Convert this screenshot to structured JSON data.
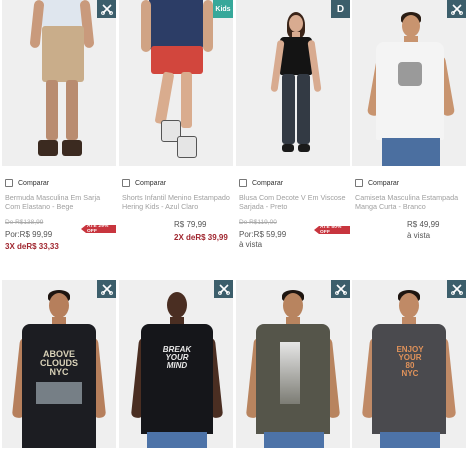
{
  "colors": {
    "badge": "#3c5e6b",
    "badge_kids": "#36a89a",
    "sale": "#a0262f",
    "promo": "#c8353e"
  },
  "compare_label": "Comparar",
  "products_top": [
    {
      "badge": "scissors-icon",
      "name": "Bermuda Masculina Em Sarja Com Elastano - Bege",
      "old_price": "De R$138,99",
      "price": "Por:R$ 99,99",
      "installment": "3X deR$ 33,33",
      "promo": "ATÉ 29% OFF"
    },
    {
      "badge_text": "Kids",
      "name": "Shorts Infantil Menino Estampado Hering Kids - Azul Claro",
      "price": "R$ 79,99",
      "installment": "2X deR$ 39,99"
    },
    {
      "badge_text": "D",
      "name": "Blusa Com Decote V Em Viscose Sarjada - Preto",
      "old_price": "De R$119,00",
      "price": "Por:R$ 59,99",
      "vista": "à vista",
      "promo": "ATÉ 50% OFF"
    },
    {
      "badge": "scissors-icon",
      "name": "Camiseta Masculina Estampada Manga Curta - Branco",
      "price": "R$ 49,99",
      "vista": "à vista"
    }
  ],
  "products_bottom": [
    {
      "badge": "scissors-icon",
      "print": "ABOVE\nCLOUDS\nNYC"
    },
    {
      "badge": "scissors-icon",
      "print": "BREAK\nYOUR\nMIND"
    },
    {
      "badge": "scissors-icon",
      "print": ""
    },
    {
      "badge": "scissors-icon",
      "print": "ENJOY\nYOUR\n80\nNYC"
    }
  ]
}
